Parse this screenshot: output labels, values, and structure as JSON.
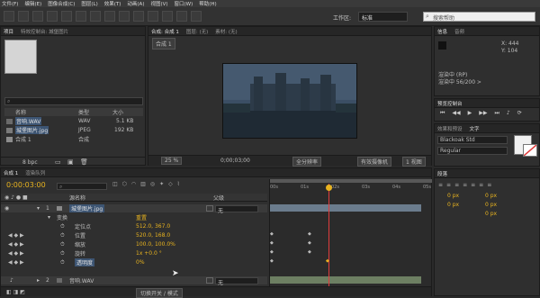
{
  "menu": [
    "文件(F)",
    "编辑(E)",
    "图像合成(C)",
    "图层(L)",
    "效果(T)",
    "动画(A)",
    "视图(V)",
    "窗口(W)",
    "帮助(H)"
  ],
  "workspace": {
    "label": "工作区:",
    "value": "标准",
    "search_placeholder": "搜索帮助"
  },
  "project": {
    "tab_project": "项目",
    "tab_effects": "特效控制台: 城堡图片",
    "columns": {
      "name": "名称",
      "type": "类型",
      "size": "大小"
    },
    "items": [
      {
        "name": "音响.WAV",
        "type": "WAV",
        "size": "5.1 KB"
      },
      {
        "name": "城堡图片.jpg",
        "type": "JPEG",
        "size": "192 KB"
      },
      {
        "name": "合成 1",
        "type": "合成",
        "size": ""
      }
    ],
    "bpc": "8 bpc"
  },
  "composition": {
    "tab": "合成: 合成 1",
    "tab2": "图层: (无)",
    "tab3": "素材: (无)",
    "crumb": "合成 1",
    "zoom": "25 %",
    "timecode": "0;00;03;00",
    "quality": "全分辨率",
    "camera": "有效摄像机",
    "views": "1 视图"
  },
  "info": {
    "tab_info": "信息",
    "tab_audio": "音频",
    "x": "X: 444",
    "y": "Y: 104",
    "preview_label": "渲染中 (RP)",
    "preview_value": "渲染中 56/200 >"
  },
  "preview": {
    "tab": "预览控制台"
  },
  "character": {
    "tab_effects": "效果和预设",
    "tab_char": "文字",
    "font": "Blackoak Std",
    "style": "Regular"
  },
  "paragraph": {
    "tab": "段落",
    "px": [
      "0 px",
      "0 px",
      "0 px",
      "0 px",
      "0 px"
    ]
  },
  "timeline": {
    "tab": "合成 1",
    "render_queue": "渲染队列",
    "timecode": "0:00:03:00",
    "columns": {
      "source": "源名称",
      "parent": "父级"
    },
    "ticks": [
      "00s",
      "01s",
      "02s",
      "03s",
      "04s",
      "05s"
    ],
    "current_time_fraction": 0.36,
    "layers": [
      {
        "num": "1",
        "name": "城堡图片.jpg",
        "parent": "无"
      },
      {
        "num": "2",
        "name": "音响.WAV",
        "parent": "无"
      }
    ],
    "transform": {
      "label": "变换",
      "reset": "重置"
    },
    "props": [
      {
        "name": "定位点",
        "value": "512.0, 367.0"
      },
      {
        "name": "位置",
        "value": "520.0, 168.0"
      },
      {
        "name": "缩放",
        "value": "100.0, 100.0%"
      },
      {
        "name": "旋转",
        "value": "1x +0.0 °"
      },
      {
        "name": "透明度",
        "value": "0%"
      }
    ],
    "mode_button": "切换开关 / 模式"
  },
  "colors": {
    "accent": "#e8b31f",
    "playhead": "#e03c3c",
    "bg": "#2a2a2a"
  }
}
